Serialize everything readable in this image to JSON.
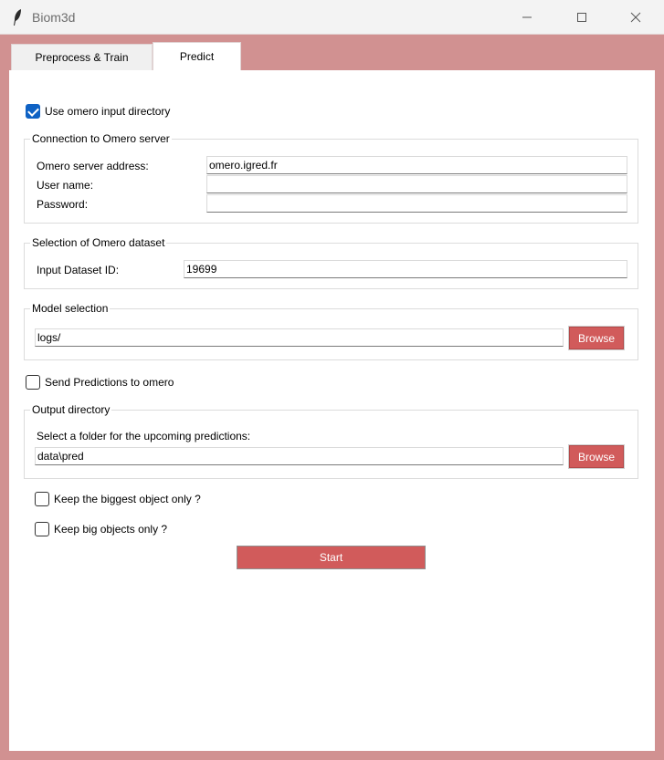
{
  "window": {
    "title": "Biom3d",
    "app_icon": "feather-icon",
    "controls": [
      "minimize-icon",
      "maximize-icon",
      "close-icon"
    ]
  },
  "tabs": [
    {
      "label": "Preprocess & Train",
      "selected": false
    },
    {
      "label": "Predict",
      "selected": true
    }
  ],
  "omero_input": {
    "label": "Use omero input directory",
    "checked": true
  },
  "connection": {
    "legend": "Connection to Omero server",
    "server_label": "Omero server address:",
    "server_value": "omero.igred.fr",
    "user_label": "User name:",
    "user_value": "",
    "password_label": "Password:",
    "password_value": ""
  },
  "dataset": {
    "legend": "Selection of Omero dataset",
    "id_label": "Input Dataset ID:",
    "id_value": "19699"
  },
  "model": {
    "legend": "Model selection",
    "path_value": "logs/",
    "browse_label": "Browse"
  },
  "send_predictions": {
    "label": "Send Predictions to omero",
    "checked": false
  },
  "output": {
    "legend": "Output directory",
    "prompt": "Select a folder for the upcoming predictions:",
    "path_value": "data\\pred",
    "browse_label": "Browse"
  },
  "options": {
    "biggest_label": "Keep the biggest object only ?",
    "biggest_checked": false,
    "big_label": "Keep big objects only ?",
    "big_checked": false
  },
  "start_label": "Start",
  "colors": {
    "accent": "#d15b5b",
    "frame": "#d19191",
    "checkbox_checked": "#0f62c4"
  }
}
